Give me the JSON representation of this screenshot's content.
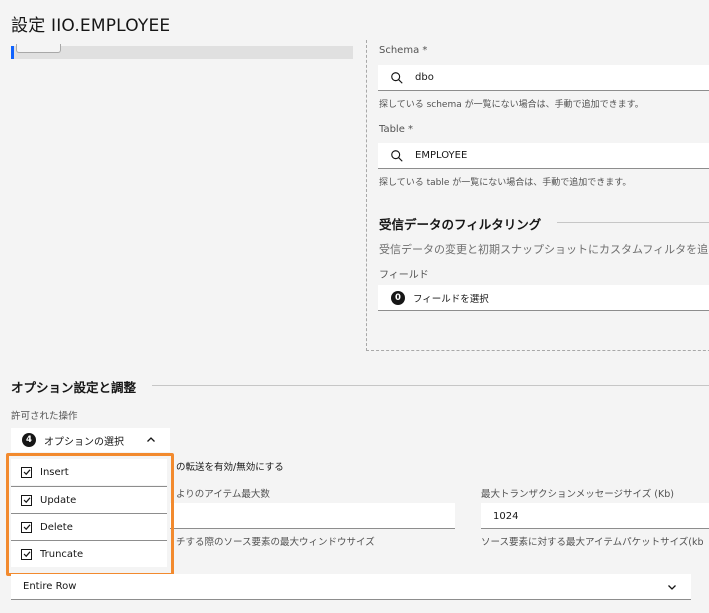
{
  "page": {
    "title": "設定 IIO.EMPLOYEE"
  },
  "schema": {
    "label": "Schema *",
    "value": "dbo",
    "helper": "探している schema が一覧にない場合は、手動で追加できます。"
  },
  "table": {
    "label": "Table *",
    "value": "EMPLOYEE",
    "helper": "探している table が一覧にない場合は、手動で追加できます。"
  },
  "filtering": {
    "title": "受信データのフィルタリング",
    "description": "受信データの変更と初期スナップショットにカスタムフィルタを追",
    "field_label": "フィールド",
    "selected_count": "0",
    "field_placeholder": "フィールドを選択"
  },
  "options": {
    "title": "オプション設定と調整",
    "allowed_ops_label": "許可された操作",
    "selected_count": "4",
    "trigger_label": "オプションの選択",
    "items": [
      {
        "label": "Insert",
        "checked": true
      },
      {
        "label": "Update",
        "checked": true
      },
      {
        "label": "Delete",
        "checked": true
      },
      {
        "label": "Truncate",
        "checked": true
      }
    ],
    "ops_helper_partial": "の転送を有効/無効にする",
    "max_items_label_partial": "よりのアイテム最大数",
    "window_helper_partial": "チする際のソース要素の最大ウィンドウサイズ",
    "max_tx_label": "最大トランザクションメッセージサイズ (Kb)",
    "max_tx_value": "1024",
    "packet_helper": "ソース要素に対する最大アイテムパケットサイズ(kb",
    "row_select_value": "Entire Row"
  },
  "colors": {
    "highlight": "#f28a2e",
    "accent": "#0f62fe"
  }
}
